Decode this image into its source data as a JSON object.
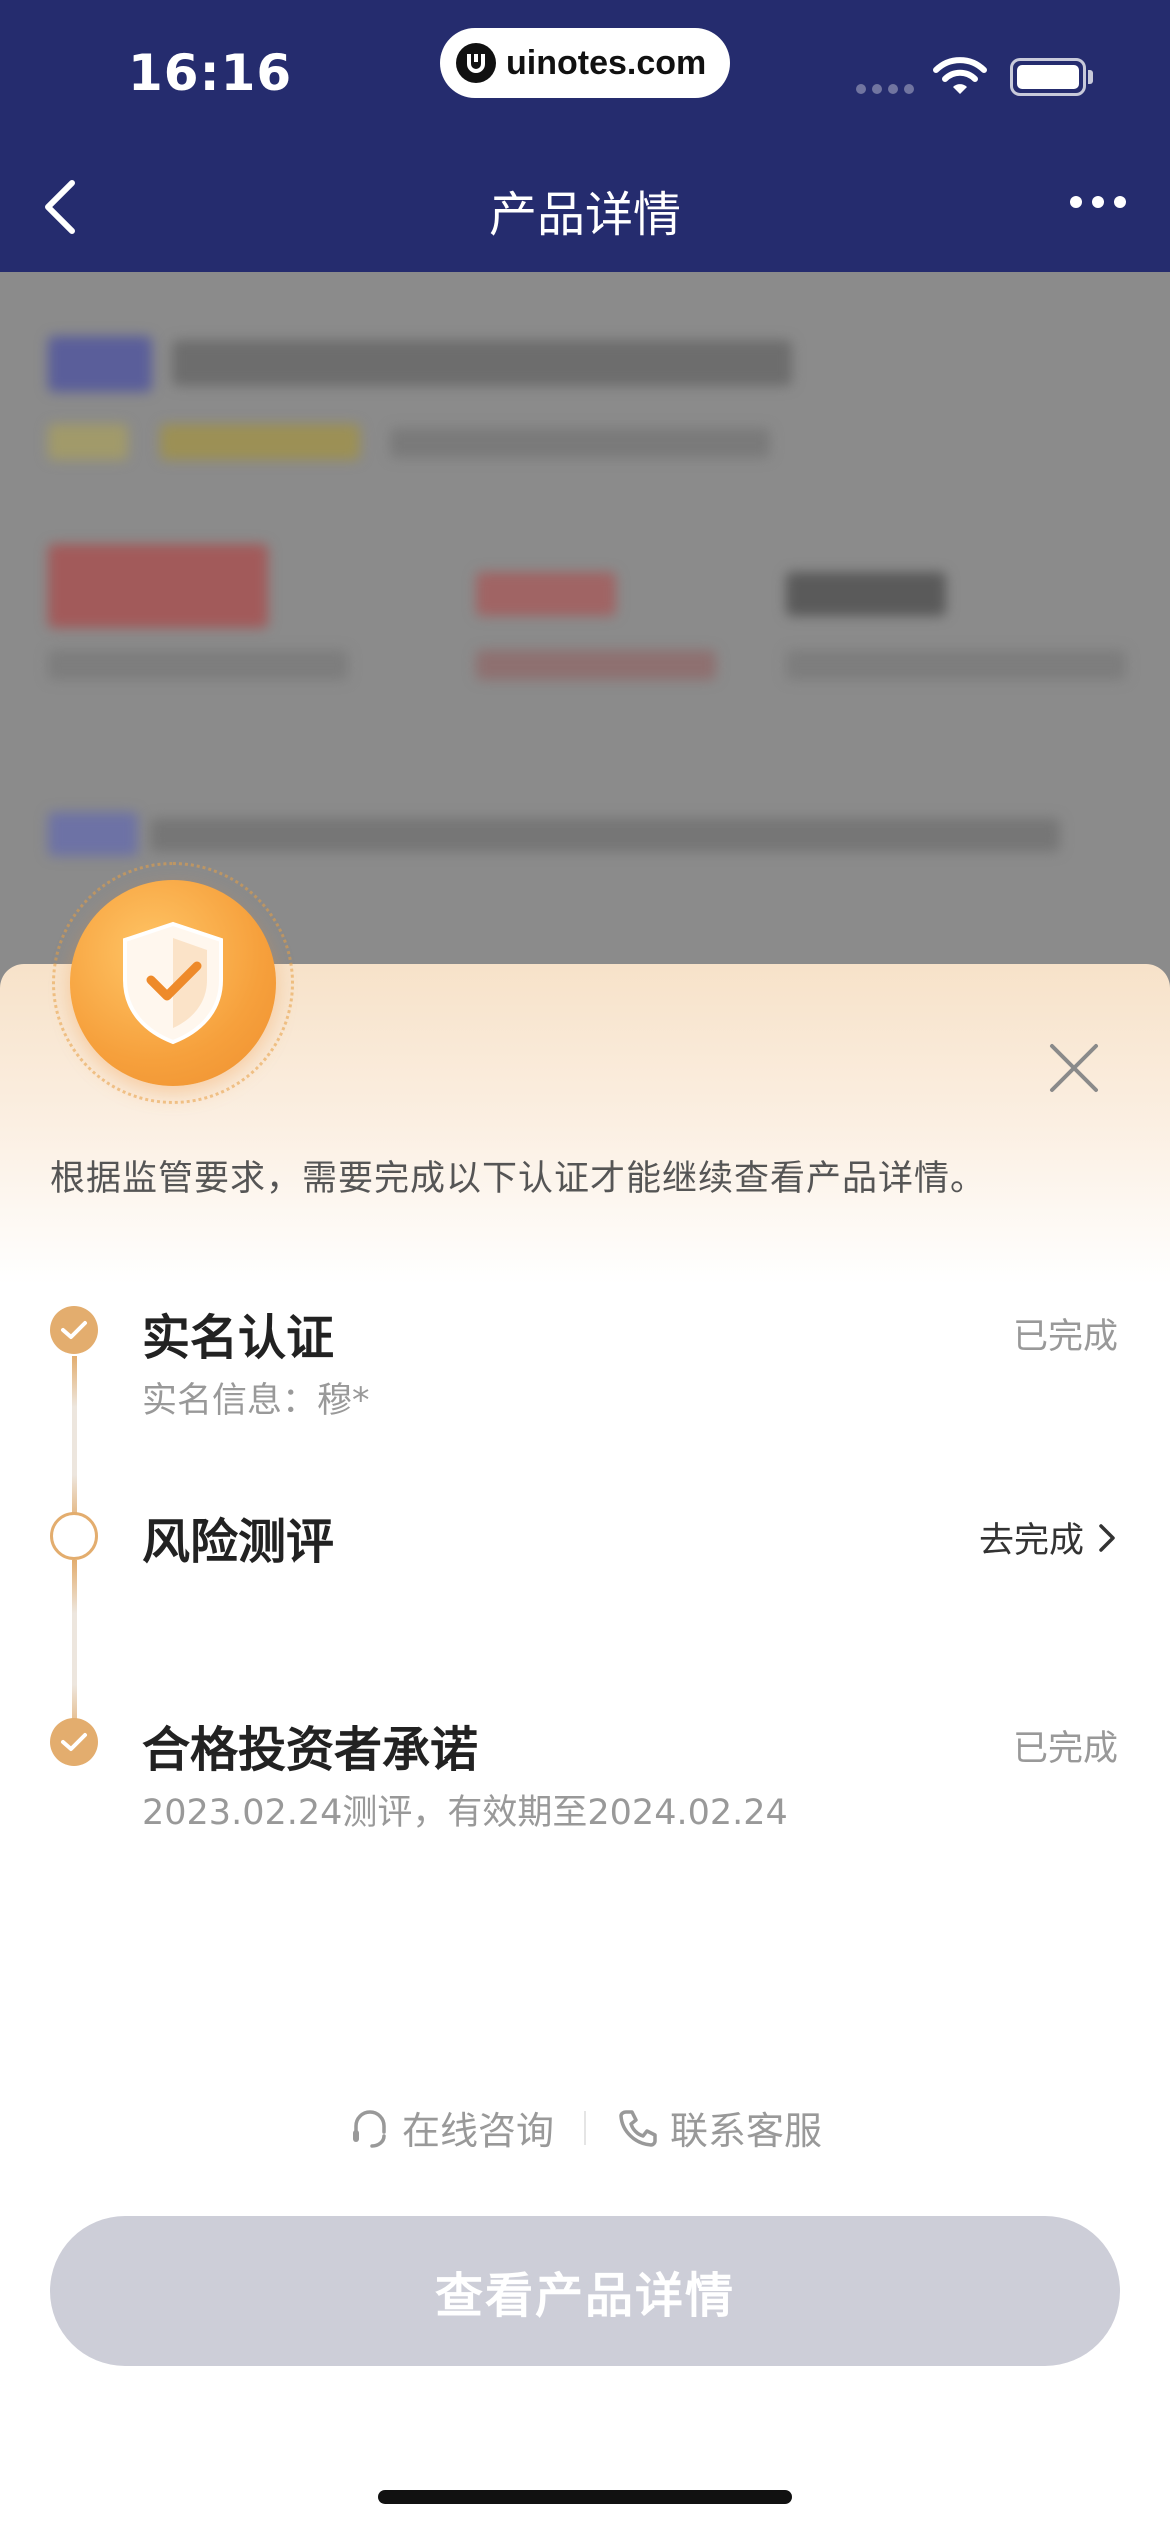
{
  "status_bar": {
    "time": "16:16",
    "url": "uinotes.com"
  },
  "nav": {
    "title": "产品详情",
    "back_icon": "chevron-left-icon",
    "more_icon": "more-dots-icon"
  },
  "sheet": {
    "notice": "根据监管要求，需要完成以下认证才能继续查看产品详情。",
    "close_icon": "close-icon",
    "steps": [
      {
        "title": "实名认证",
        "subtitle": "实名信息：穆*",
        "status": "已完成",
        "done": true
      },
      {
        "title": "风险测评",
        "subtitle": "",
        "action": "去完成",
        "done": false
      },
      {
        "title": "合格投资者承诺",
        "subtitle": "2023.02.24测评，有效期至2024.02.24",
        "status": "已完成",
        "done": true
      }
    ],
    "links": {
      "online": "在线咨询",
      "service": "联系客服"
    },
    "primary_button": "查看产品详情"
  },
  "colors": {
    "header_bg": "#252c6e",
    "accent_gold": "#e3ad6e",
    "badge_orange": "#f6a03c",
    "button_disabled": "#cdced8"
  }
}
